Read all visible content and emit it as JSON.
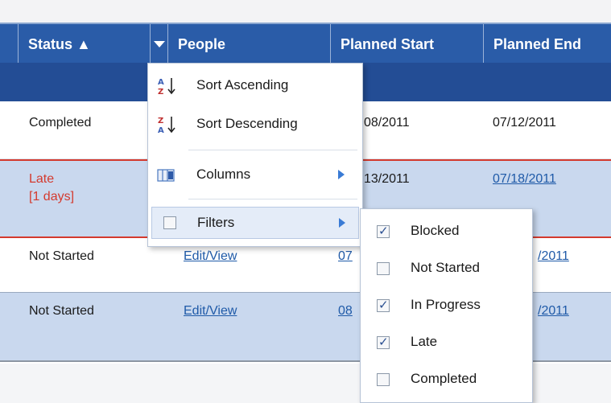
{
  "columns": {
    "status": "Status ▲",
    "people": "People",
    "planned_start": "Planned Start",
    "planned_end": "Planned End"
  },
  "rows": [
    {
      "status": "Completed",
      "status_detail": "",
      "people": "",
      "planned_start": "08/2011",
      "planned_end": "07/12/2011"
    },
    {
      "status": "Late",
      "status_detail": "[1 days]",
      "people": "",
      "planned_start": "13/2011",
      "planned_end": "07/18/2011"
    },
    {
      "status": "Not Started",
      "status_detail": "",
      "people": "Edit/View",
      "planned_start": "07",
      "planned_end": "/2011"
    },
    {
      "status": "Not Started",
      "status_detail": "",
      "people": "Edit/View",
      "planned_start": "08",
      "planned_end": "/2011"
    }
  ],
  "menu": {
    "sort_ascending": "Sort Ascending",
    "sort_descending": "Sort Descending",
    "columns": "Columns",
    "filters": "Filters"
  },
  "filters": [
    {
      "label": "Blocked",
      "checked": true
    },
    {
      "label": "Not Started",
      "checked": false
    },
    {
      "label": "In Progress",
      "checked": true
    },
    {
      "label": "Late",
      "checked": true
    },
    {
      "label": "Completed",
      "checked": false
    }
  ],
  "colors": {
    "header_bg": "#2a5ca8",
    "subheader_bg": "#234d95",
    "row_alt_bg": "#c9d8ee",
    "late_text": "#d43a2e",
    "link": "#1f5aa8"
  }
}
